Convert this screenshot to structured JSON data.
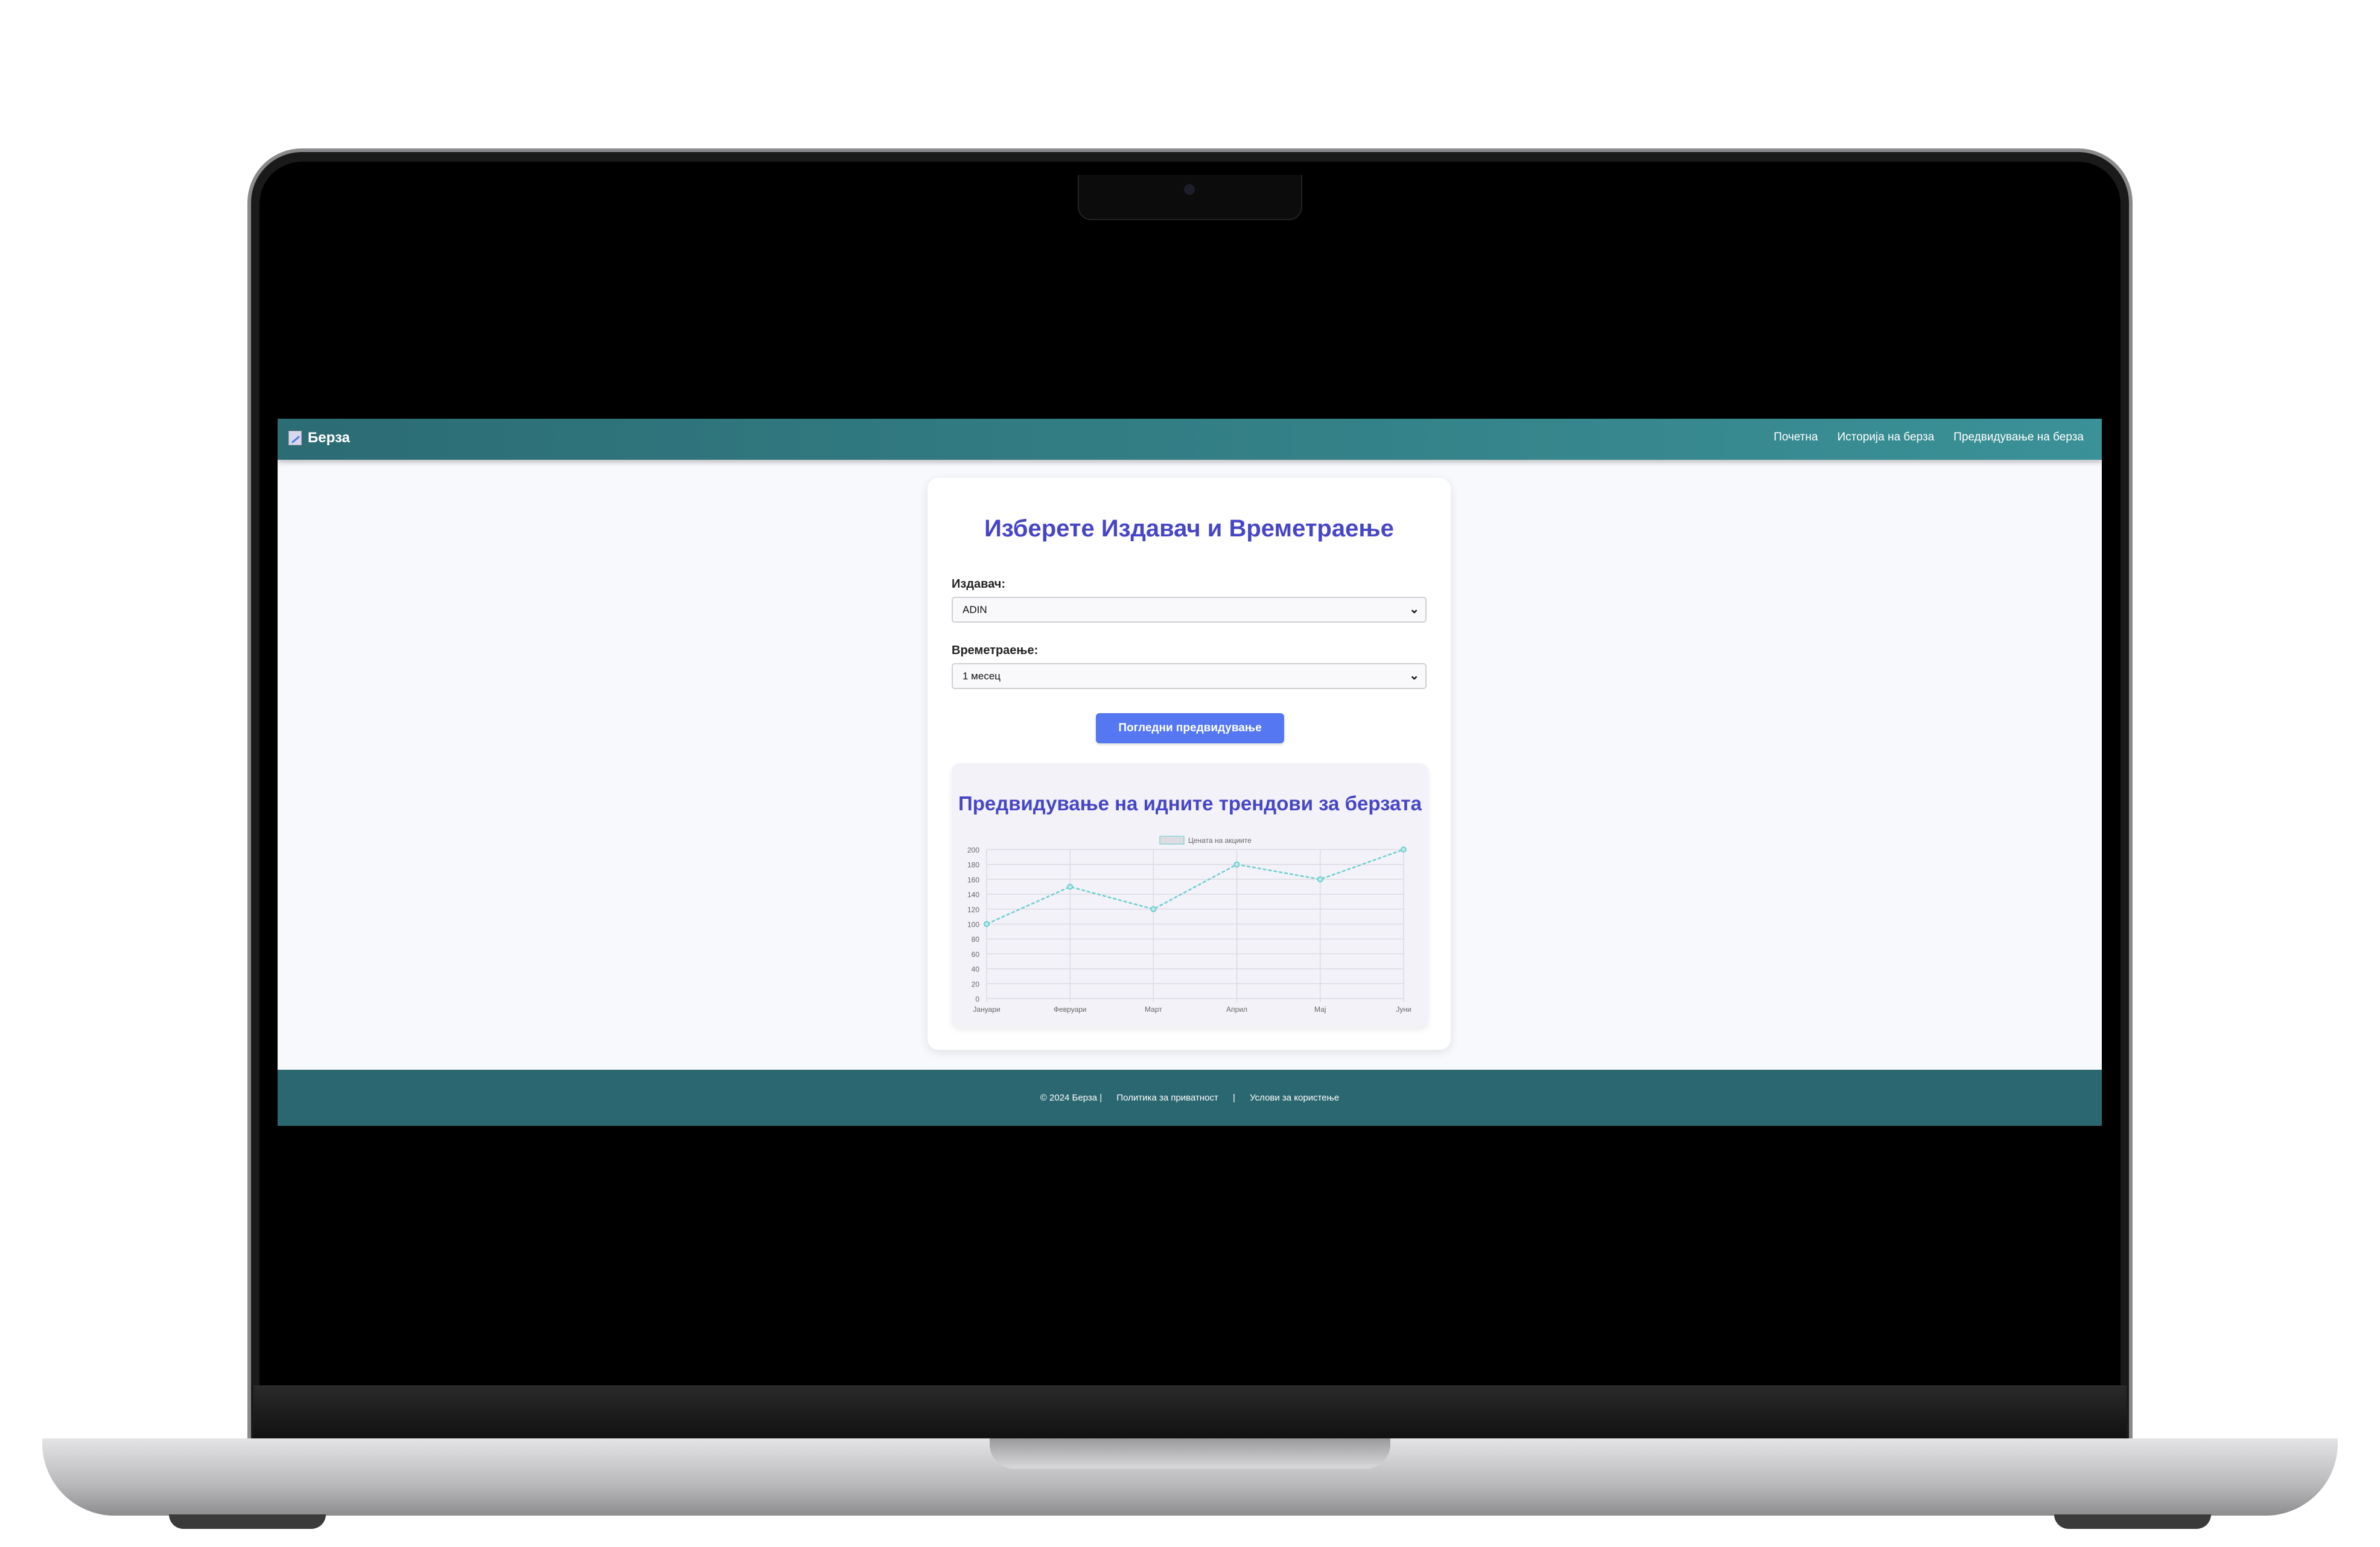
{
  "navbar": {
    "brand": "Берза",
    "links": [
      "Почетна",
      "Историја на берза",
      "Предвидување на берза"
    ]
  },
  "form": {
    "title": "Изберете Издавач и Времетраење",
    "issuer_label": "Издавач:",
    "issuer_value": "ADIN",
    "duration_label": "Времетраење:",
    "duration_value": "1 месец",
    "submit_label": "Погледни предвидување"
  },
  "chart_title": "Предвидување на идните трендови за берзата",
  "chart_data": {
    "type": "line",
    "categories": [
      "Јануари",
      "Февруари",
      "Март",
      "Април",
      "Мај",
      "Јуни"
    ],
    "series": [
      {
        "name": "Цената на акциите",
        "values": [
          100,
          150,
          120,
          180,
          160,
          200
        ]
      }
    ],
    "ylim": [
      0,
      200
    ],
    "yticks": [
      0,
      20,
      40,
      60,
      80,
      100,
      120,
      140,
      160,
      180,
      200
    ],
    "grid": true,
    "legend": "top",
    "line_color": "#6fcfd0",
    "line_style": "dashed"
  },
  "footer": {
    "copyright": "© 2024 Берза |",
    "privacy": "Политика за приватност",
    "sep": "|",
    "terms": "Услови за користење"
  }
}
